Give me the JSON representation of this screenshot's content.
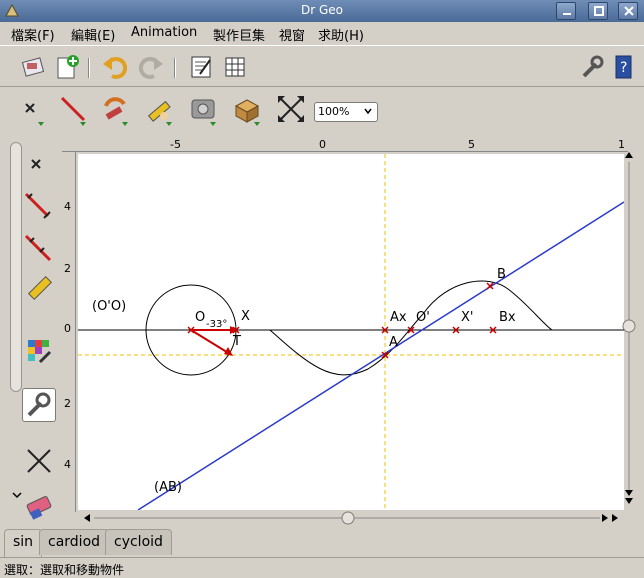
{
  "window": {
    "title": "Dr Geo"
  },
  "menu": {
    "items": [
      "檔案(F)",
      "編輯(E)",
      "Animation",
      "製作巨集",
      "視窗",
      "求助(H)"
    ]
  },
  "toolbar2": {
    "zoom": "100%"
  },
  "ruler": {
    "top": [
      "-5",
      "0",
      "5",
      "1"
    ],
    "left": [
      "4",
      "2",
      "0",
      "2",
      "4"
    ]
  },
  "drawing": {
    "labels": {
      "circle": "(O'O)",
      "O": "O",
      "X": "X",
      "T": "T",
      "Ax": "Ax",
      "Oprime": "O'",
      "Xprime": "X'",
      "Bx": "Bx",
      "A": "A",
      "B": "B",
      "line": "(AB)",
      "angle": "-33°"
    }
  },
  "tabs": [
    "sin",
    "cardiod",
    "cycloid"
  ],
  "status": {
    "text": "選取：選取和移動物件"
  },
  "colors": {
    "line": "#2a3acb",
    "vector": "#cc0000",
    "guide": "#f2c200"
  }
}
